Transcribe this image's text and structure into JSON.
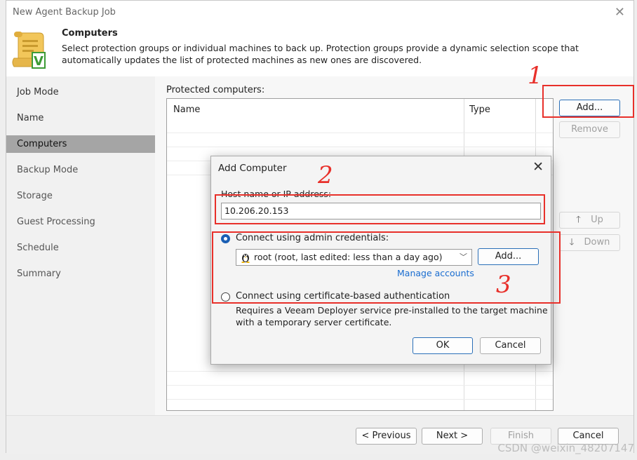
{
  "window": {
    "title": "New Agent Backup Job",
    "close_glyph": "✕"
  },
  "header": {
    "title": "Computers",
    "description": "Select protection groups or individual machines to back up. Protection groups provide a dynamic selection scope that automatically updates the list of protected machines as new ones are discovered.",
    "icon": "scroll-checkmark-icon"
  },
  "sidebar": {
    "items": [
      {
        "label": "Job Mode"
      },
      {
        "label": "Name"
      },
      {
        "label": "Computers"
      },
      {
        "label": "Backup Mode"
      },
      {
        "label": "Storage"
      },
      {
        "label": "Guest Processing"
      },
      {
        "label": "Schedule"
      },
      {
        "label": "Summary"
      }
    ],
    "active": "Computers"
  },
  "main": {
    "protected_label": "Protected computers:",
    "columns": {
      "name": "Name",
      "type": "Type"
    },
    "buttons": {
      "add": "Add...",
      "remove": "Remove",
      "up": "Up",
      "down": "Down"
    }
  },
  "footer": {
    "previous": "< Previous",
    "next": "Next >",
    "finish": "Finish",
    "cancel": "Cancel"
  },
  "dialog": {
    "title": "Add Computer",
    "close_glyph": "✕",
    "host_label": "Host name or IP address:",
    "host_value": "10.206.20.153",
    "option_admin": "Connect using admin credentials:",
    "credential_selected": "root (root, last edited: less than a day ago)",
    "credential_add": "Add...",
    "manage_accounts": "Manage accounts",
    "option_cert": "Connect using certificate-based authentication",
    "cert_note_line1": "Requires a Veeam Deployer service pre-installed to the target machine",
    "cert_note_line2": "with a temporary server certificate.",
    "ok": "OK",
    "cancel": "Cancel"
  },
  "annotations": {
    "n1": "1",
    "n2": "2",
    "n3": "3",
    "color": "#e8302a"
  },
  "watermark": "CSDN @weixin_48207147"
}
